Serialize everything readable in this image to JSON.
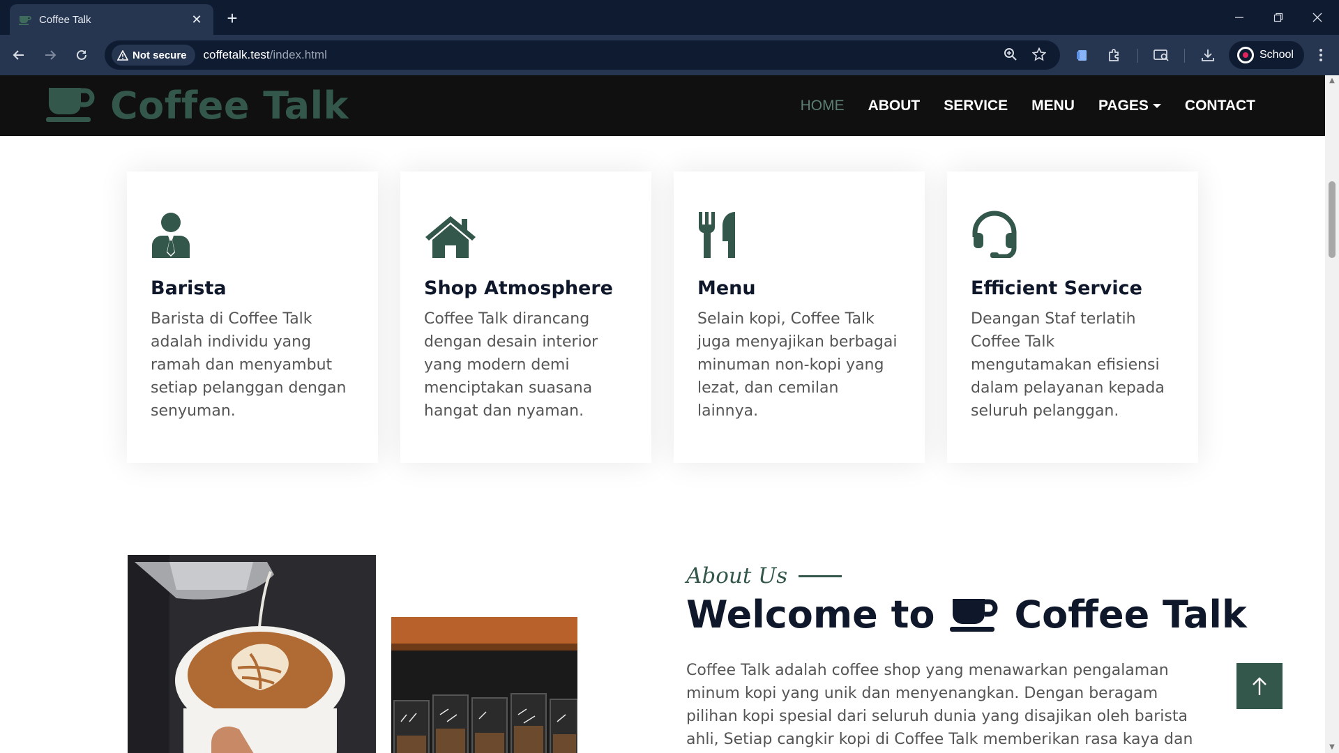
{
  "browser": {
    "tab_title": "Coffee Talk",
    "security_label": "Not secure",
    "url_host": "coffetalk.test",
    "url_path": "/index.html",
    "profile_label": "School"
  },
  "site": {
    "brand_name": "Coffee Talk",
    "nav": {
      "home": "HOME",
      "about": "ABOUT",
      "service": "SERVICE",
      "menu": "MENU",
      "pages": "PAGES",
      "contact": "CONTACT"
    },
    "colors": {
      "accent": "#33574a",
      "nav_bg": "#101010",
      "heading": "#0f172b",
      "body_text": "#555555"
    }
  },
  "features": [
    {
      "icon": "user-tie-icon",
      "title": "Barista",
      "text": "Barista di Coffee Talk adalah individu yang ramah dan menyambut setiap pelanggan dengan senyuman."
    },
    {
      "icon": "home-icon",
      "title": "Shop Atmosphere",
      "text": "Coffee Talk dirancang dengan desain interior yang modern demi menciptakan suasana hangat dan nyaman."
    },
    {
      "icon": "utensils-icon",
      "title": "Menu",
      "text": "Selain kopi, Coffee Talk juga menyajikan berbagai minuman non-kopi yang lezat, dan cemilan lainnya."
    },
    {
      "icon": "headset-icon",
      "title": "Efficient Service",
      "text": "Deangan Staf terlatih Coffee Talk mengutamakan efisiensi dalam pelayanan kepada seluruh pelanggan."
    }
  ],
  "about": {
    "eyebrow": "About Us",
    "title_prefix": "Welcome to",
    "title_brand": "Coffee Talk",
    "body": "Coffee Talk adalah coffee shop yang menawarkan pengalaman minum kopi yang unik dan menyenangkan. Dengan beragam pilihan kopi spesial dari seluruh dunia yang disajikan oleh barista ahli, Setiap cangkir kopi di Coffee Talk memberikan rasa kaya dan"
  }
}
